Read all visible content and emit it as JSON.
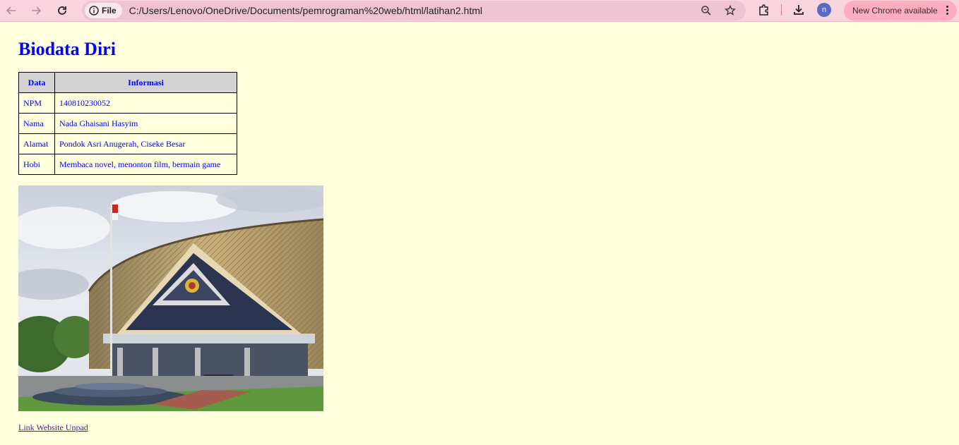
{
  "browser": {
    "file_chip": "File",
    "url": "C:/Users/Lenovo/OneDrive/Documents/pemrograman%20web/html/latihan2.html",
    "profile_initial": "n",
    "update_label": "New Chrome available"
  },
  "page": {
    "heading": "Biodata Diri",
    "table": {
      "headers": [
        "Data",
        "Informasi"
      ],
      "rows": [
        [
          "NPM",
          "140810230052"
        ],
        [
          "Nama",
          "Nada Ghaisani Hasyim"
        ],
        [
          "Alamat",
          "Pondok Asri Anugerah, Ciseke Besar"
        ],
        [
          "Hobi",
          "Membaca novel, menonton film, bermain game"
        ]
      ]
    },
    "link_text": "Link Website Unpad"
  },
  "colors": {
    "page_bg": "#ffffde",
    "text_blue": "#0000ff",
    "header_bg": "#d3d3d3",
    "visited_link": "#551a8b"
  }
}
